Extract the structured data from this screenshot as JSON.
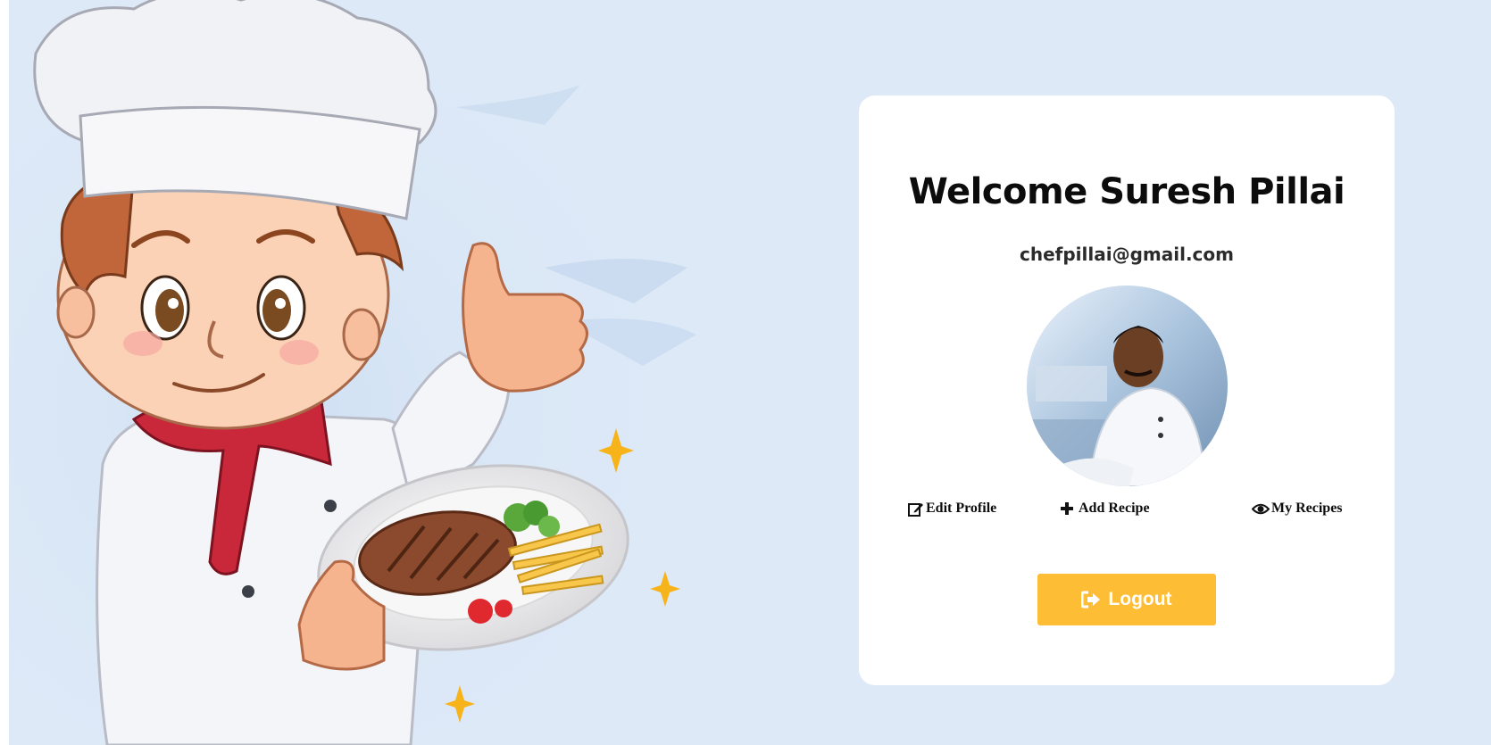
{
  "card": {
    "title": "Welcome Suresh Pillai",
    "email": "chefpillai@gmail.com",
    "avatar_icon": "chef-photo",
    "actions": [
      {
        "label": "Edit Profile",
        "icon": "edit-icon"
      },
      {
        "label": "Add Recipe",
        "icon": "plus-icon"
      },
      {
        "label": "My Recipes",
        "icon": "eye-icon"
      }
    ],
    "logout": {
      "label": "Logout",
      "icon": "sign-out-icon"
    }
  },
  "colors": {
    "background": "#dde9f7",
    "card": "#ffffff",
    "logout_button": "#fdbd35"
  }
}
